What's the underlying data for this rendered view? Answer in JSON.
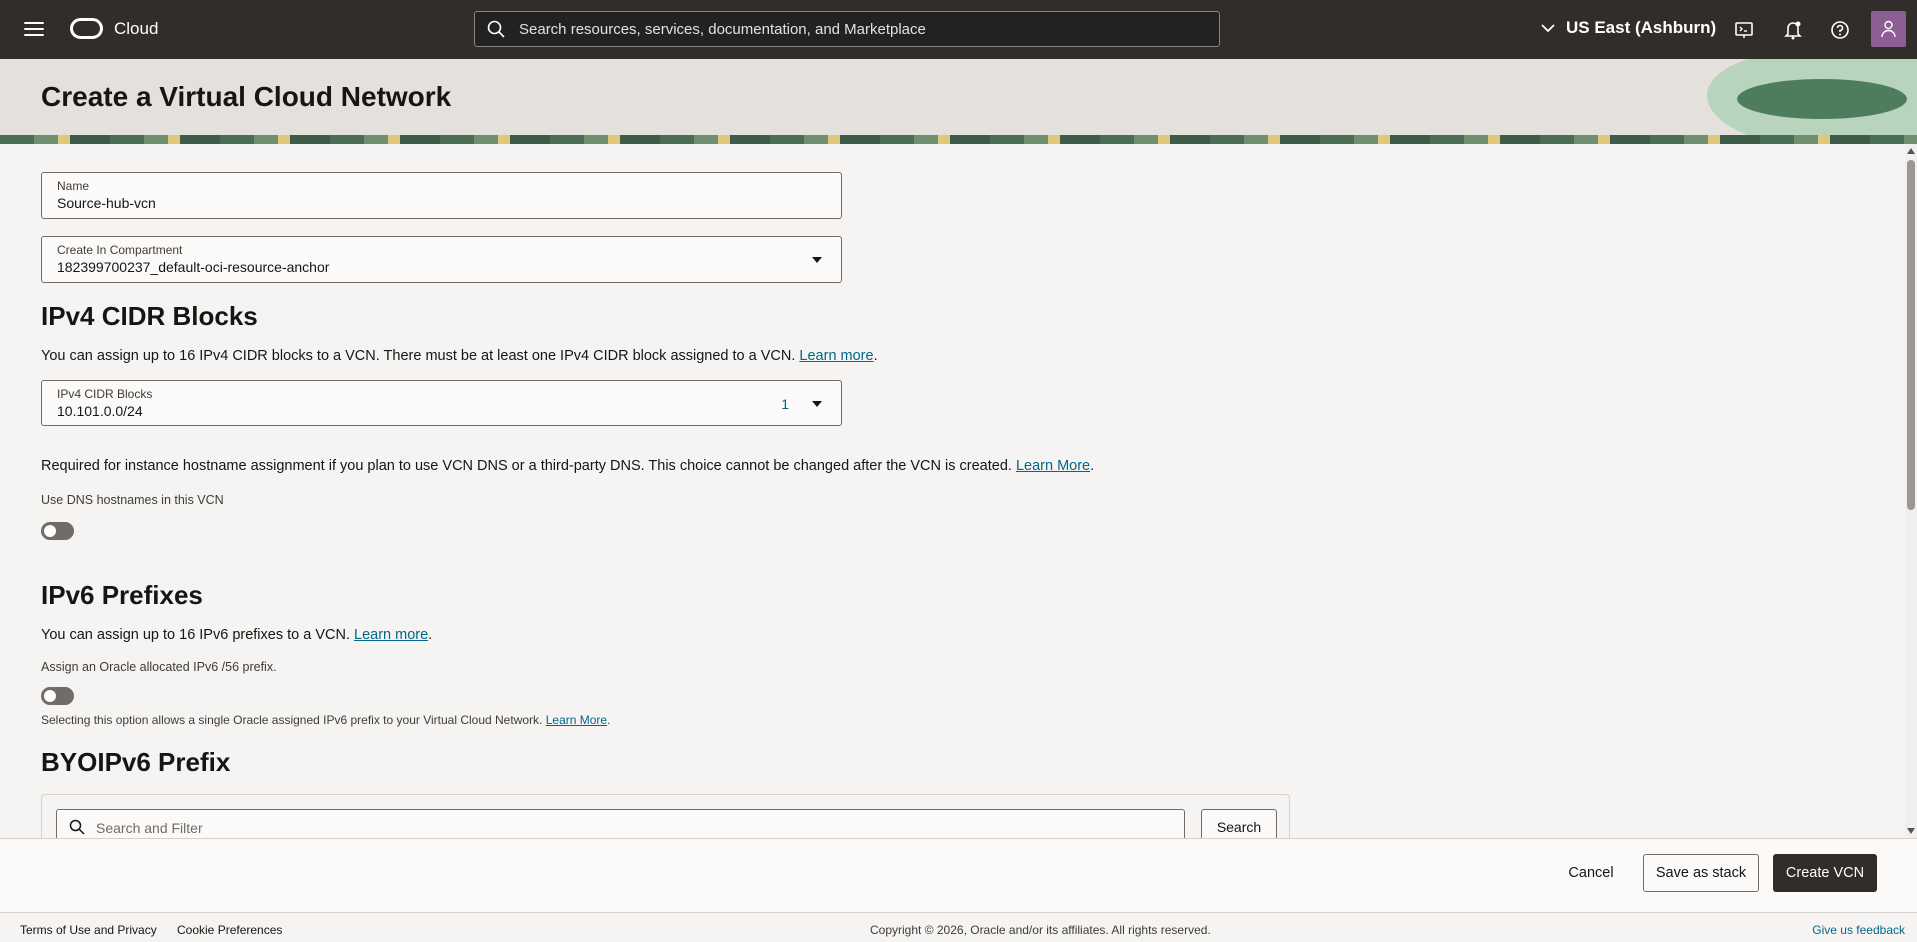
{
  "topbar": {
    "brand": "Cloud",
    "search_placeholder": "Search resources, services, documentation, and Marketplace",
    "region": "US East (Ashburn)",
    "icons": [
      "menu-icon",
      "oracle-logo",
      "search-icon",
      "chevron-down-icon",
      "cloud-shell-icon",
      "bell-icon",
      "help-icon",
      "user-icon"
    ]
  },
  "header": {
    "title": "Create a Virtual Cloud Network"
  },
  "form": {
    "name": {
      "label": "Name",
      "value": "Source-hub-vcn"
    },
    "compartment": {
      "label": "Create In Compartment",
      "value": "182399700237_default-oci-resource-anchor"
    },
    "ipv4": {
      "heading": "IPv4 CIDR Blocks",
      "description": "You can assign up to 16 IPv4 CIDR blocks to a VCN. There must be at least one IPv4 CIDR block assigned to a VCN.",
      "learn_more": "Learn more",
      "field_label": "IPv4 CIDR Blocks",
      "field_value": "10.101.0.0/24",
      "count": "1"
    },
    "dns": {
      "description": "Required for instance hostname assignment if you plan to use VCN DNS or a third-party DNS. This choice cannot be changed after the VCN is created.",
      "learn_more": "Learn More",
      "toggle_label": "Use DNS hostnames in this VCN",
      "enabled": false
    },
    "ipv6": {
      "heading": "IPv6 Prefixes",
      "description": "You can assign up to 16 IPv6 prefixes to a VCN.",
      "learn_more": "Learn more",
      "toggle_label": "Assign an Oracle allocated IPv6 /56 prefix.",
      "enabled": false,
      "hint": "Selecting this option allows a single Oracle assigned IPv6 prefix to your Virtual Cloud Network.",
      "hint_link": "Learn More"
    },
    "byoipv6": {
      "heading": "BYOIPv6 Prefix",
      "search_placeholder": "Search and Filter",
      "search_button": "Search"
    }
  },
  "actions": {
    "cancel": "Cancel",
    "save_stack": "Save as stack",
    "create": "Create VCN"
  },
  "footer": {
    "terms": "Terms of Use and Privacy",
    "cookies": "Cookie Preferences",
    "copyright": "Copyright © 2026, Oracle and/or its affiliates. All rights reserved.",
    "feedback": "Give us feedback"
  }
}
